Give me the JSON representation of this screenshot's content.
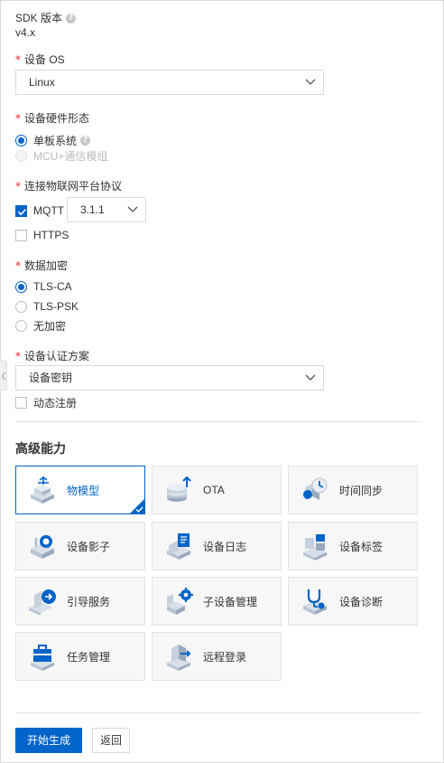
{
  "sdk": {
    "label": "SDK 版本",
    "value": "v4.x"
  },
  "os": {
    "label": "设备 OS",
    "value": "Linux"
  },
  "hardware": {
    "label": "设备硬件形态",
    "options": [
      {
        "label": "单板系统",
        "checked": true,
        "disabled": false
      },
      {
        "label": "MCU+通信模组",
        "checked": false,
        "disabled": true
      }
    ]
  },
  "protocol": {
    "label": "连接物联网平台协议",
    "mqtt_label": "MQTT",
    "mqtt_version": "3.1.1",
    "https_label": "HTTPS"
  },
  "encryption": {
    "label": "数据加密",
    "options": [
      "TLS-CA",
      "TLS-PSK",
      "无加密"
    ],
    "selected": "TLS-CA"
  },
  "auth": {
    "label": "设备认证方案",
    "value": "设备密钥",
    "dynamic_register": "动态注册"
  },
  "advanced": {
    "title": "高级能力",
    "items": [
      {
        "label": "物模型",
        "icon": "thing-model-icon",
        "selected": true
      },
      {
        "label": "OTA",
        "icon": "ota-icon",
        "selected": false
      },
      {
        "label": "时间同步",
        "icon": "time-sync-icon",
        "selected": false
      },
      {
        "label": "设备影子",
        "icon": "device-shadow-icon",
        "selected": false
      },
      {
        "label": "设备日志",
        "icon": "device-log-icon",
        "selected": false
      },
      {
        "label": "设备标签",
        "icon": "device-tag-icon",
        "selected": false
      },
      {
        "label": "引导服务",
        "icon": "bootstrap-icon",
        "selected": false
      },
      {
        "label": "子设备管理",
        "icon": "subdevice-icon",
        "selected": false
      },
      {
        "label": "设备诊断",
        "icon": "diagnosis-icon",
        "selected": false
      },
      {
        "label": "任务管理",
        "icon": "job-icon",
        "selected": false
      },
      {
        "label": "远程登录",
        "icon": "remote-login-icon",
        "selected": false
      }
    ]
  },
  "actions": {
    "generate": "开始生成",
    "back": "返回"
  },
  "colors": {
    "primary": "#0064c8",
    "required": "#f5222d"
  }
}
